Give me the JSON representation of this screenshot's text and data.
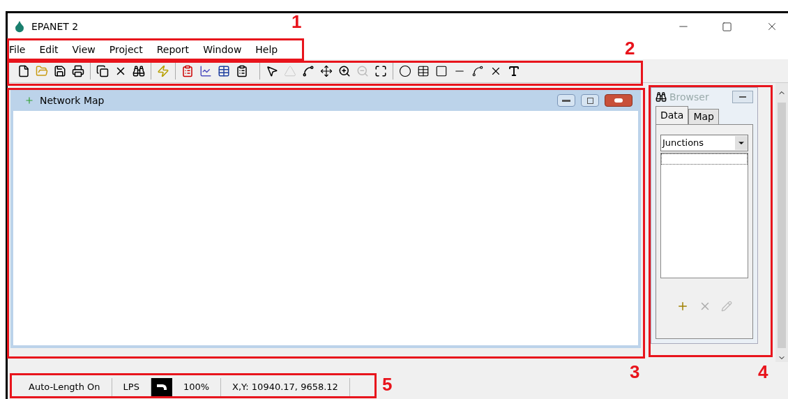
{
  "window": {
    "title": "EPANET 2"
  },
  "menu": [
    "File",
    "Edit",
    "View",
    "Project",
    "Report",
    "Window",
    "Help"
  ],
  "map_window": {
    "title": "Network Map"
  },
  "browser": {
    "title": "Browser",
    "tabs": [
      {
        "label": "Data",
        "selected": true
      },
      {
        "label": "Map",
        "selected": false
      }
    ],
    "dropdown": {
      "value": "Junctions"
    }
  },
  "status_bar": [
    {
      "kind": "text",
      "text": "Auto-Length On"
    },
    {
      "kind": "text",
      "text": "LPS"
    },
    {
      "kind": "icon"
    },
    {
      "kind": "text",
      "text": "100%"
    },
    {
      "kind": "text",
      "text": "X,Y: 10940.17, 9658.12"
    }
  ],
  "annotations": [
    "1",
    "2",
    "3",
    "4",
    "5"
  ]
}
